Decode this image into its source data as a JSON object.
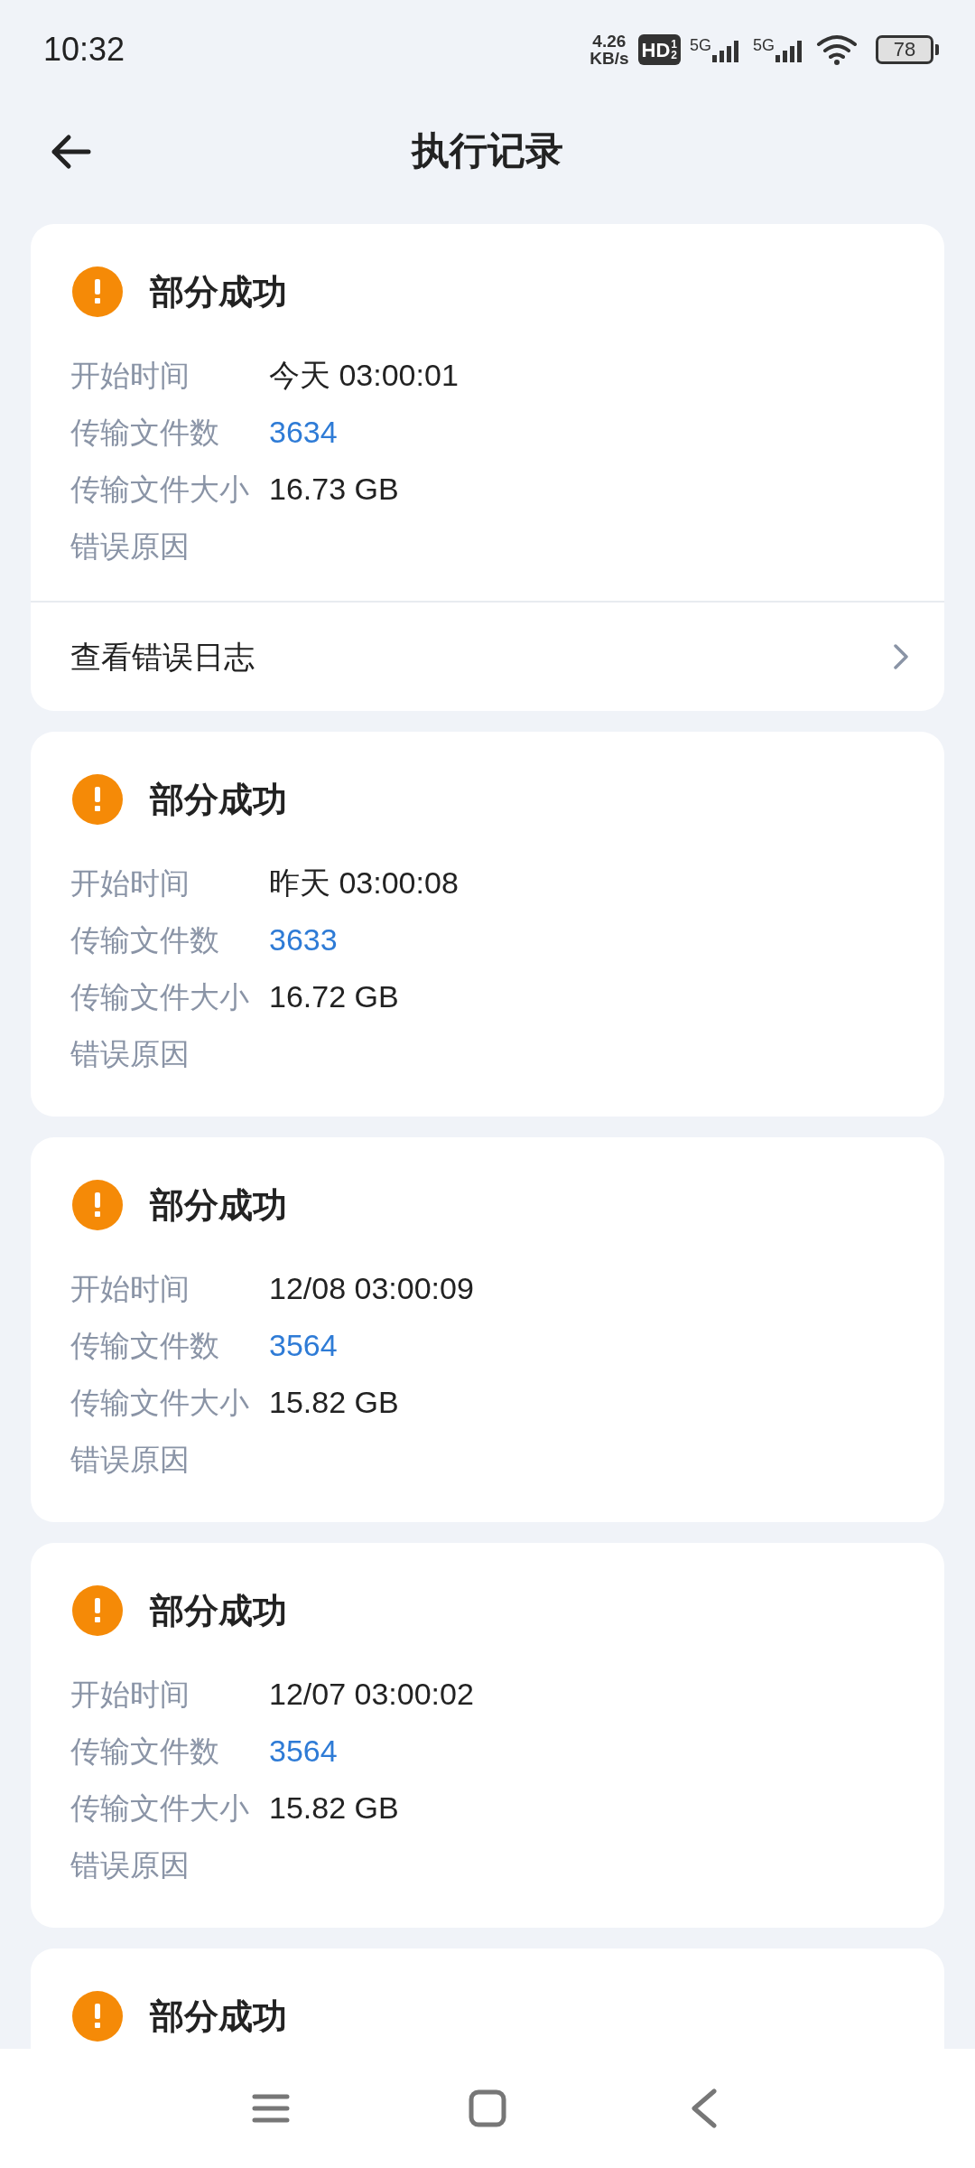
{
  "status_bar": {
    "time": "10:32",
    "speed_value": "4.26",
    "speed_unit": "KB/s",
    "hd_label": "HD",
    "hd_sims": [
      "1",
      "2"
    ],
    "networks": [
      "5G",
      "5G"
    ],
    "battery": "78"
  },
  "header": {
    "title": "执行记录"
  },
  "records": [
    {
      "status": "部分成功",
      "kind": "warning",
      "fields": [
        {
          "label": "开始时间",
          "value": "今天 03:00:01",
          "kind": "text"
        },
        {
          "label": "传输文件数",
          "value": "3634",
          "kind": "count"
        },
        {
          "label": "传输文件大小",
          "value": "16.73 GB",
          "kind": "text"
        },
        {
          "label": "错误原因"
        }
      ],
      "link": "查看错误日志"
    },
    {
      "status": "部分成功",
      "kind": "warning",
      "fields": [
        {
          "label": "开始时间",
          "value": "昨天 03:00:08",
          "kind": "text"
        },
        {
          "label": "传输文件数",
          "value": "3633",
          "kind": "count"
        },
        {
          "label": "传输文件大小",
          "value": "16.72 GB",
          "kind": "text"
        },
        {
          "label": "错误原因"
        }
      ]
    },
    {
      "status": "部分成功",
      "kind": "warning",
      "fields": [
        {
          "label": "开始时间",
          "value": "12/08 03:00:09",
          "kind": "text"
        },
        {
          "label": "传输文件数",
          "value": "3564",
          "kind": "count"
        },
        {
          "label": "传输文件大小",
          "value": "15.82 GB",
          "kind": "text"
        },
        {
          "label": "错误原因"
        }
      ]
    },
    {
      "status": "部分成功",
      "kind": "warning",
      "fields": [
        {
          "label": "开始时间",
          "value": "12/07 03:00:02",
          "kind": "text"
        },
        {
          "label": "传输文件数",
          "value": "3564",
          "kind": "count"
        },
        {
          "label": "传输文件大小",
          "value": "15.82 GB",
          "kind": "text"
        },
        {
          "label": "错误原因"
        }
      ]
    },
    {
      "status": "部分成功",
      "kind": "warning"
    }
  ]
}
